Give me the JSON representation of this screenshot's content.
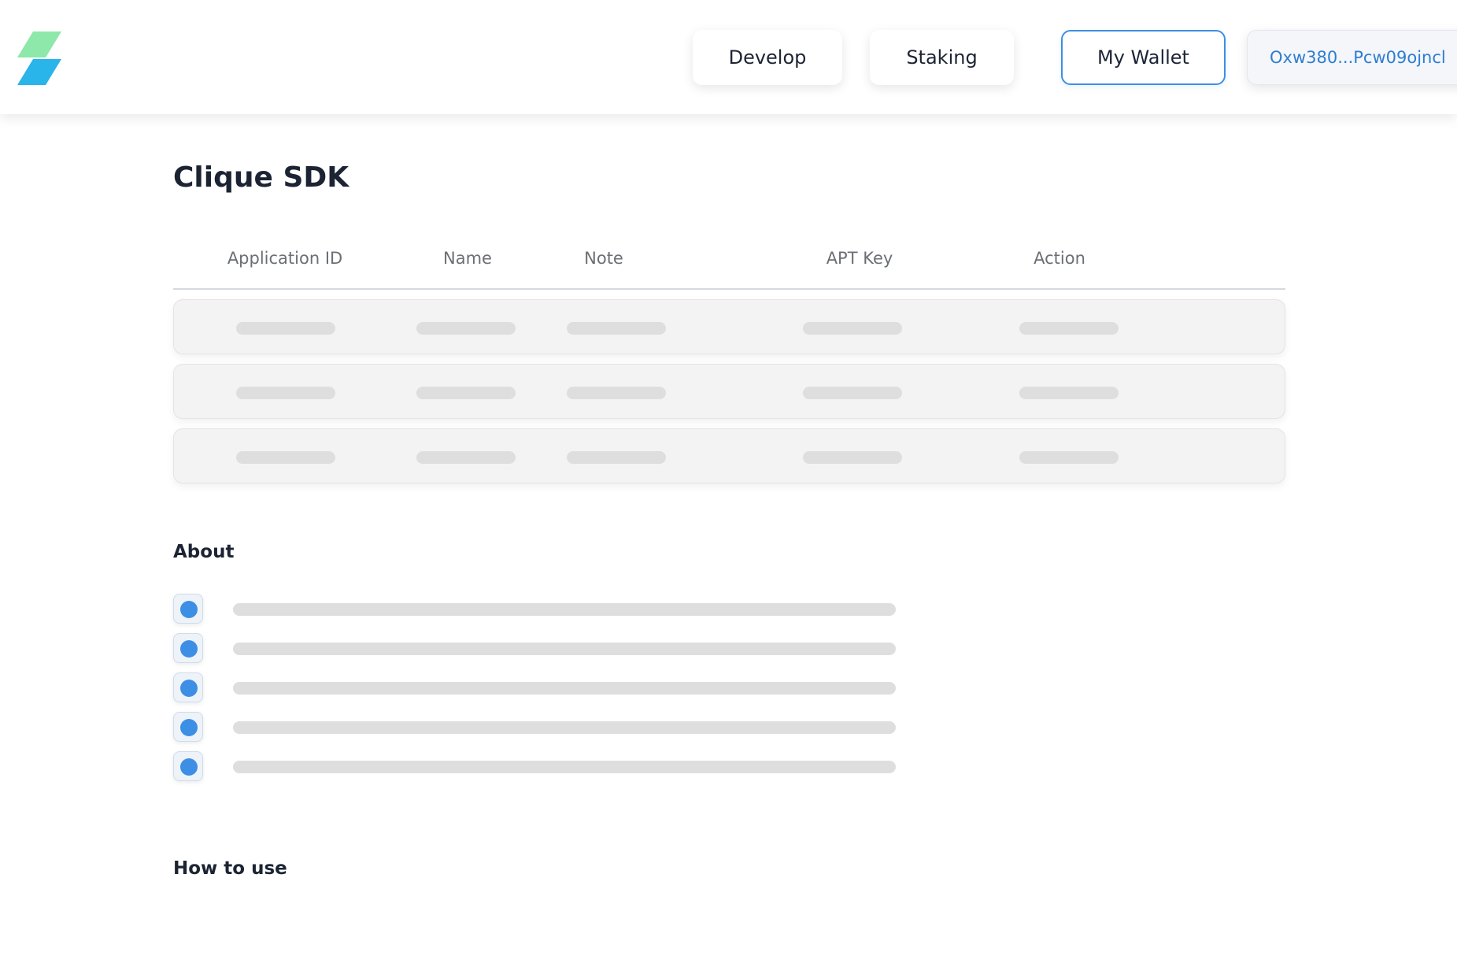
{
  "header": {
    "logo_name": "brand-logo",
    "nav": {
      "develop_label": "Develop",
      "staking_label": "Staking",
      "wallet_label": "My Wallet",
      "address_label": "Oxw380...Pcw09ojncl"
    },
    "colors": {
      "logo_top": "#8ee8a9",
      "logo_bottom": "#29b4ea",
      "accent": "#3d8fe5",
      "address_text": "#2d7dd2"
    }
  },
  "main": {
    "title": "Clique SDK",
    "table": {
      "columns": [
        "Application ID",
        "Name",
        "Note",
        "APT Key",
        "Action"
      ],
      "row_count": 3
    },
    "about": {
      "title": "About",
      "item_count": 5
    },
    "how_to_use": {
      "title": "How to use"
    }
  }
}
